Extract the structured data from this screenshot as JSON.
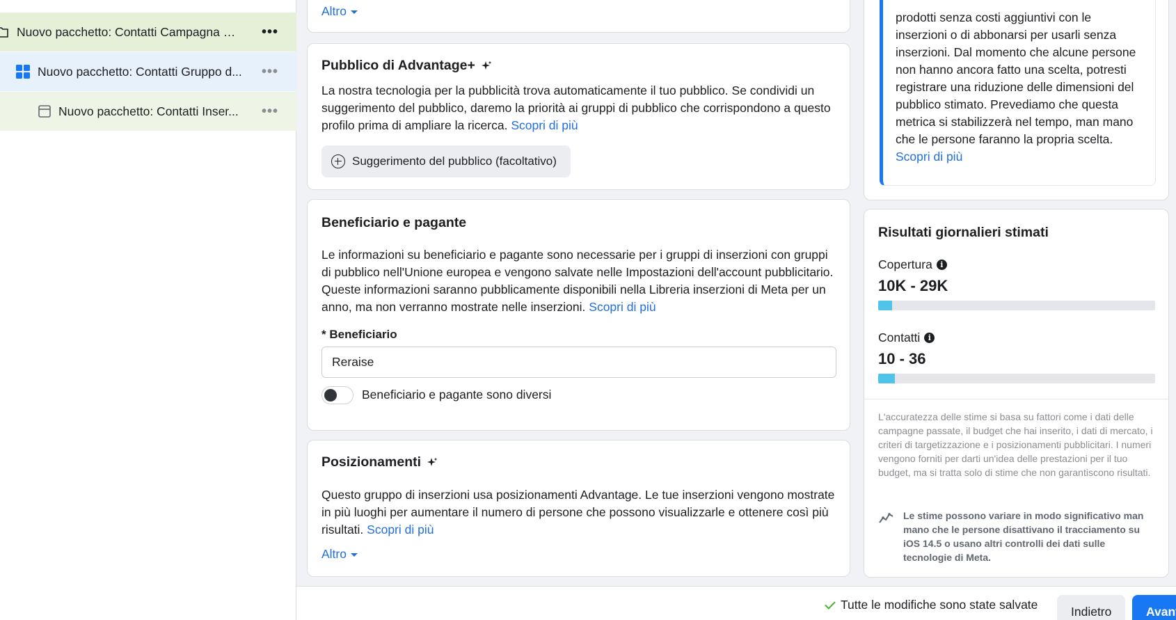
{
  "sidebar": {
    "campaign_label": "Nuovo pacchetto: Contatti Campagna c...",
    "adset_label": "Nuovo pacchetto: Contatti Gruppo d...",
    "ad_label": "Nuovo pacchetto: Contatti Inser...",
    "more_glyph": "•••"
  },
  "top_card": {
    "altro": "Altro"
  },
  "advantage_audience": {
    "title": "Pubblico di Advantage+",
    "description": "La nostra tecnologia per la pubblicità trova automaticamente il tuo pubblico. Se condividi un suggerimento del pubblico, daremo la priorità ai gruppi di pubblico che corrispondono a questo profilo prima di ampliare la ricerca.",
    "learn_more": "Scopri di più",
    "suggestion_button": "Suggerimento del pubblico (facoltativo)"
  },
  "beneficiary": {
    "title": "Beneficiario e pagante",
    "description": "Le informazioni su beneficiario e pagante sono necessarie per i gruppi di inserzioni con gruppi di pubblico nell'Unione europea e vengono salvate nelle Impostazioni dell'account pubblicitario. Queste informazioni saranno pubblicamente disponibili nella Libreria inserzioni di Meta per un anno, ma non verranno mostrate nelle inserzioni.",
    "learn_more": "Scopri di più",
    "field_label": "* Beneficiario",
    "field_value": "Reraise",
    "toggle_label": "Beneficiario e pagante sono diversi",
    "toggle_on": false
  },
  "placements": {
    "title": "Posizionamenti",
    "description": "Questo gruppo di inserzioni usa posizionamenti Advantage. Le tue inserzioni vengono mostrate in più luoghi per aumentare il numero di persone che possono visualizzarle e ottenere così più risultati.",
    "learn_more": "Scopri di più",
    "altro": "Altro"
  },
  "notice": {
    "text": "prodotti senza costi aggiuntivi con le inserzioni o di abbonarsi per usarli senza inserzioni. Dal momento che alcune persone non hanno ancora fatto una scelta, potresti registrare una riduzione delle dimensioni del pubblico stimato. Prevediamo che questa metrica si stabilizzerà nel tempo, man mano che le persone faranno la propria scelta.",
    "learn_more": "Scopri di più"
  },
  "results": {
    "title": "Risultati giornalieri stimati",
    "reach_label": "Copertura",
    "reach_value": "10K - 29K",
    "reach_fill": 0.05,
    "contacts_label": "Contatti",
    "contacts_value": "10 - 36",
    "contacts_fill": 0.06,
    "disclaimer": "L'accuratezza delle stime si basa su fattori come i dati delle campagne passate, il budget che hai inserito, i dati di mercato, i criteri di targetizzazione e i posizionamenti pubblicitari. I numeri vengono forniti per darti un'idea delle prestazioni per il tuo budget, ma si tratta solo di stime che non garantiscono risultati.",
    "ios_note": "Le stime possono variare in modo significativo man mano che le persone disattivano il tracciamento su iOS 14.5 o usano altri controlli dei dati sulle tecnologie di Meta."
  },
  "footer": {
    "saved_status": "Tutte le modifiche sono state salvate",
    "back_label": "Indietro",
    "next_label": "Avanti"
  },
  "colors": {
    "accent": "#1877f2",
    "link": "#216fdb",
    "bar": "#4fc3e8",
    "success": "#42b72a"
  }
}
